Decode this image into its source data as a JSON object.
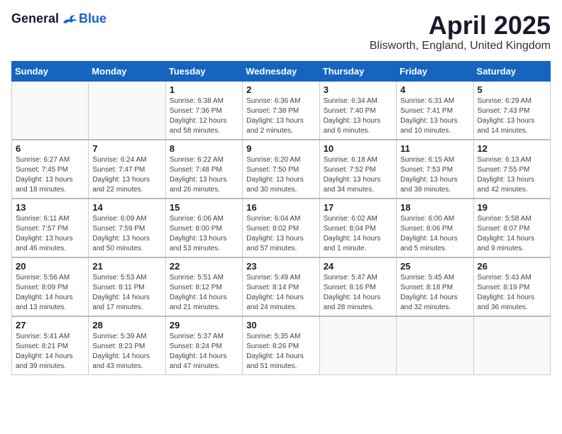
{
  "logo": {
    "general": "General",
    "blue": "Blue"
  },
  "title": "April 2025",
  "location": "Blisworth, England, United Kingdom",
  "headers": [
    "Sunday",
    "Monday",
    "Tuesday",
    "Wednesday",
    "Thursday",
    "Friday",
    "Saturday"
  ],
  "weeks": [
    [
      {
        "day": "",
        "info": ""
      },
      {
        "day": "",
        "info": ""
      },
      {
        "day": "1",
        "info": "Sunrise: 6:38 AM\nSunset: 7:36 PM\nDaylight: 12 hours\nand 58 minutes."
      },
      {
        "day": "2",
        "info": "Sunrise: 6:36 AM\nSunset: 7:38 PM\nDaylight: 13 hours\nand 2 minutes."
      },
      {
        "day": "3",
        "info": "Sunrise: 6:34 AM\nSunset: 7:40 PM\nDaylight: 13 hours\nand 6 minutes."
      },
      {
        "day": "4",
        "info": "Sunrise: 6:31 AM\nSunset: 7:41 PM\nDaylight: 13 hours\nand 10 minutes."
      },
      {
        "day": "5",
        "info": "Sunrise: 6:29 AM\nSunset: 7:43 PM\nDaylight: 13 hours\nand 14 minutes."
      }
    ],
    [
      {
        "day": "6",
        "info": "Sunrise: 6:27 AM\nSunset: 7:45 PM\nDaylight: 13 hours\nand 18 minutes."
      },
      {
        "day": "7",
        "info": "Sunrise: 6:24 AM\nSunset: 7:47 PM\nDaylight: 13 hours\nand 22 minutes."
      },
      {
        "day": "8",
        "info": "Sunrise: 6:22 AM\nSunset: 7:48 PM\nDaylight: 13 hours\nand 26 minutes."
      },
      {
        "day": "9",
        "info": "Sunrise: 6:20 AM\nSunset: 7:50 PM\nDaylight: 13 hours\nand 30 minutes."
      },
      {
        "day": "10",
        "info": "Sunrise: 6:18 AM\nSunset: 7:52 PM\nDaylight: 13 hours\nand 34 minutes."
      },
      {
        "day": "11",
        "info": "Sunrise: 6:15 AM\nSunset: 7:53 PM\nDaylight: 13 hours\nand 38 minutes."
      },
      {
        "day": "12",
        "info": "Sunrise: 6:13 AM\nSunset: 7:55 PM\nDaylight: 13 hours\nand 42 minutes."
      }
    ],
    [
      {
        "day": "13",
        "info": "Sunrise: 6:11 AM\nSunset: 7:57 PM\nDaylight: 13 hours\nand 46 minutes."
      },
      {
        "day": "14",
        "info": "Sunrise: 6:09 AM\nSunset: 7:59 PM\nDaylight: 13 hours\nand 50 minutes."
      },
      {
        "day": "15",
        "info": "Sunrise: 6:06 AM\nSunset: 8:00 PM\nDaylight: 13 hours\nand 53 minutes."
      },
      {
        "day": "16",
        "info": "Sunrise: 6:04 AM\nSunset: 8:02 PM\nDaylight: 13 hours\nand 57 minutes."
      },
      {
        "day": "17",
        "info": "Sunrise: 6:02 AM\nSunset: 8:04 PM\nDaylight: 14 hours\nand 1 minute."
      },
      {
        "day": "18",
        "info": "Sunrise: 6:00 AM\nSunset: 8:06 PM\nDaylight: 14 hours\nand 5 minutes."
      },
      {
        "day": "19",
        "info": "Sunrise: 5:58 AM\nSunset: 8:07 PM\nDaylight: 14 hours\nand 9 minutes."
      }
    ],
    [
      {
        "day": "20",
        "info": "Sunrise: 5:56 AM\nSunset: 8:09 PM\nDaylight: 14 hours\nand 13 minutes."
      },
      {
        "day": "21",
        "info": "Sunrise: 5:53 AM\nSunset: 8:11 PM\nDaylight: 14 hours\nand 17 minutes."
      },
      {
        "day": "22",
        "info": "Sunrise: 5:51 AM\nSunset: 8:12 PM\nDaylight: 14 hours\nand 21 minutes."
      },
      {
        "day": "23",
        "info": "Sunrise: 5:49 AM\nSunset: 8:14 PM\nDaylight: 14 hours\nand 24 minutes."
      },
      {
        "day": "24",
        "info": "Sunrise: 5:47 AM\nSunset: 8:16 PM\nDaylight: 14 hours\nand 28 minutes."
      },
      {
        "day": "25",
        "info": "Sunrise: 5:45 AM\nSunset: 8:18 PM\nDaylight: 14 hours\nand 32 minutes."
      },
      {
        "day": "26",
        "info": "Sunrise: 5:43 AM\nSunset: 8:19 PM\nDaylight: 14 hours\nand 36 minutes."
      }
    ],
    [
      {
        "day": "27",
        "info": "Sunrise: 5:41 AM\nSunset: 8:21 PM\nDaylight: 14 hours\nand 39 minutes."
      },
      {
        "day": "28",
        "info": "Sunrise: 5:39 AM\nSunset: 8:23 PM\nDaylight: 14 hours\nand 43 minutes."
      },
      {
        "day": "29",
        "info": "Sunrise: 5:37 AM\nSunset: 8:24 PM\nDaylight: 14 hours\nand 47 minutes."
      },
      {
        "day": "30",
        "info": "Sunrise: 5:35 AM\nSunset: 8:26 PM\nDaylight: 14 hours\nand 51 minutes."
      },
      {
        "day": "",
        "info": ""
      },
      {
        "day": "",
        "info": ""
      },
      {
        "day": "",
        "info": ""
      }
    ]
  ]
}
